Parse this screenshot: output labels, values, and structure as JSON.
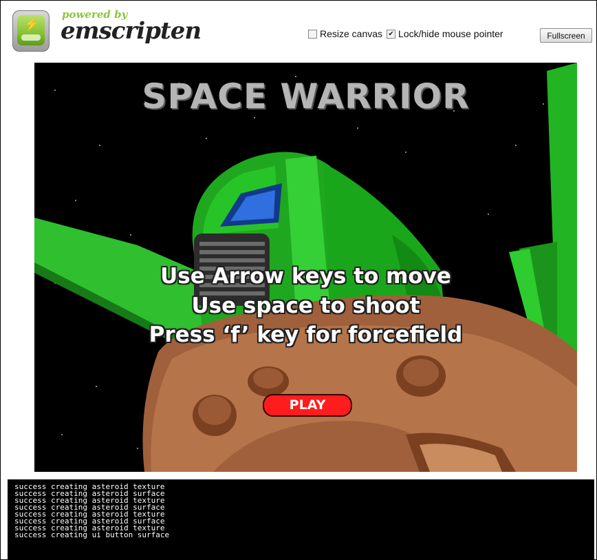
{
  "header": {
    "powered_text": "powered by",
    "brand_text": "emscripten",
    "resize_canvas_label": "Resize canvas",
    "resize_canvas_checked": false,
    "lock_pointer_label": "Lock/hide mouse pointer",
    "lock_pointer_checked": true,
    "fullscreen_label": "Fullscreen"
  },
  "game": {
    "title": "SPACE WARRIOR",
    "instructions": [
      "Use Arrow keys to move",
      "Use space to shoot",
      "Press ‘f’ key for forcefield"
    ],
    "play_label": "PLAY",
    "colors": {
      "title": "#b5b5b5",
      "ship_green": "#1faa1f",
      "asteroid": "#a0603c",
      "play_button": "#ff1c1c"
    }
  },
  "console": {
    "lines": [
      "success creating asteroid texture",
      "success creating asteroid surface",
      "success creating asteroid texture",
      "success creating asteroid surface",
      "success creating asteroid texture",
      "success creating asteroid surface",
      "success creating asteroid texture",
      "success creating ui button surface"
    ]
  }
}
